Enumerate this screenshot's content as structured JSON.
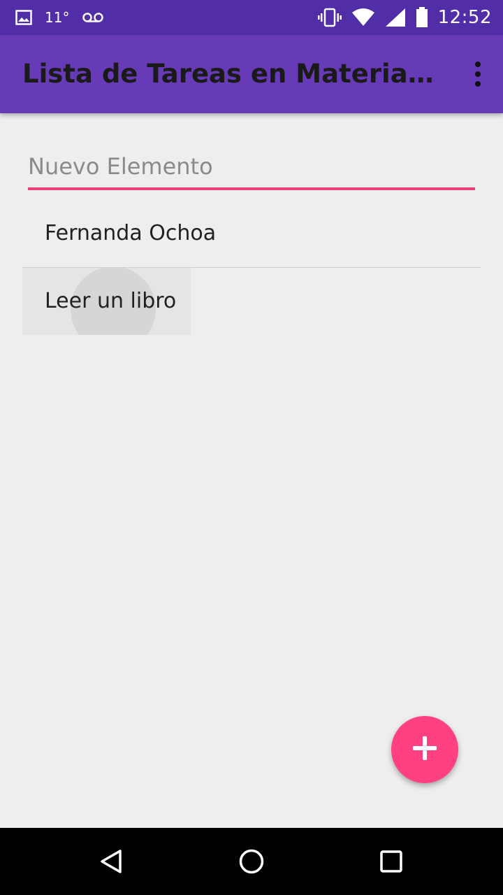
{
  "status_bar": {
    "temperature": "11°",
    "time": "12:52",
    "icons": [
      "gallery-icon",
      "voicemail-icon",
      "vibrate-icon",
      "wifi-icon",
      "signal-icon",
      "battery-icon"
    ]
  },
  "app_bar": {
    "title": "Lista de Tareas en Material Design",
    "overflow_icon": "more-vert-icon"
  },
  "new_item": {
    "placeholder": "Nuevo Elemento",
    "value": ""
  },
  "tasks": [
    {
      "label": "Fernanda Ochoa"
    },
    {
      "label": "Leer un libro"
    }
  ],
  "fab": {
    "icon": "plus-icon"
  },
  "nav": {
    "icons": [
      "back-icon",
      "home-icon",
      "recents-icon"
    ]
  },
  "colors": {
    "status_bar": "#512da8",
    "app_bar": "#673ab7",
    "accent": "#ff4081",
    "underline": "#ec407a",
    "background": "#eeeeee"
  }
}
